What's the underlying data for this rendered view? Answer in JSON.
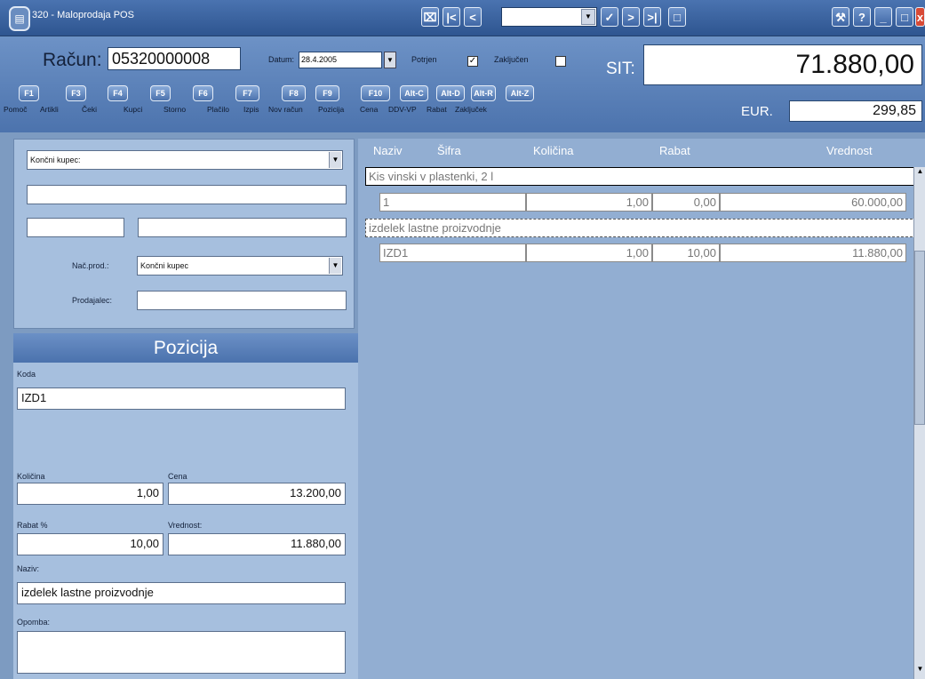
{
  "window": {
    "title": "320 - Maloprodaja POS",
    "icon": "document-icon"
  },
  "toolbar_nav": [
    "first-icon",
    "prev-icon",
    "apply-icon",
    "next-icon",
    "last-icon",
    "page-icon"
  ],
  "header": {
    "racun_label": "Račun:",
    "racun_value": "05320000008",
    "datum_label": "Datum:",
    "datum_value": "28.4.2005",
    "potrjen_label": "Potrjen",
    "potrjen_checked": true,
    "zakljucen_label": "Zaključen",
    "zakljucen_checked": false,
    "sit_label": "SIT:",
    "sit_total": "71.880,00",
    "eur_label": "EUR.",
    "eur_total": "299,85"
  },
  "function_keys": [
    {
      "key": "F1",
      "caption": "Pomoč"
    },
    {
      "key": "F3",
      "caption": "Artikli"
    },
    {
      "key": "F4",
      "caption": "Čeki"
    },
    {
      "key": "F5",
      "caption": "Kupci"
    },
    {
      "key": "F6",
      "caption": "Storno"
    },
    {
      "key": "F7",
      "caption": "Plačilo"
    },
    {
      "key": "F8",
      "caption": "Izpis"
    },
    {
      "key": "F9",
      "caption": "Nov račun"
    },
    {
      "key": "F10",
      "caption": "Pozicija"
    },
    {
      "key": "Alt-C",
      "caption": "Cena"
    },
    {
      "key": "Alt-D",
      "caption": "DDV-VP"
    },
    {
      "key": "Alt-R",
      "caption": "Rabat"
    },
    {
      "key": "Alt-Z",
      "caption": "Zaključek"
    }
  ],
  "customer": {
    "kupec_select": "Končni kupec:",
    "nac_prod_label": "Nač.prod.:",
    "nac_prod_value": "Končni kupec",
    "prodajalec_label": "Prodajalec:"
  },
  "pozicija": {
    "title": "Pozicija",
    "koda_label": "Koda",
    "koda_value": "IZD1",
    "kolicina_label": "Količina",
    "kolicina_value": "1,00",
    "cena_label": "Cena",
    "cena_value": "13.200,00",
    "rabat_label": "Rabat %",
    "rabat_value": "10,00",
    "vrednost_label": "Vrednost:",
    "vrednost_value": "11.880,00",
    "naziv_label": "Naziv:",
    "naziv_value": "izdelek lastne proizvodnje",
    "opomba_label": "Opomba:"
  },
  "grid": {
    "columns": [
      "Naziv",
      "Šifra",
      "Količina",
      "Rabat",
      "Vrednost"
    ],
    "rows": [
      {
        "name": "Kis vinski v plastenki, 2 l",
        "sifra": "1",
        "kolicina": "1,00",
        "rabat": "0,00",
        "vrednost": "60.000,00"
      },
      {
        "name": "izdelek lastne proizvodnje",
        "sifra": "IZD1",
        "kolicina": "1,00",
        "rabat": "10,00",
        "vrednost": "11.880,00"
      }
    ]
  }
}
